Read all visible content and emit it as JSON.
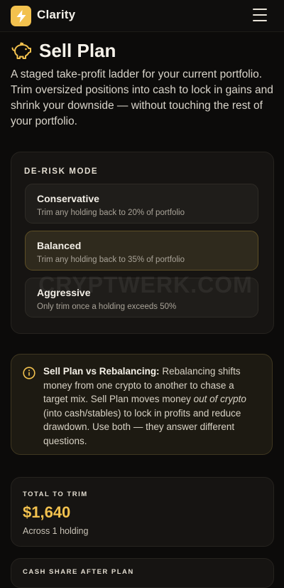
{
  "app": {
    "brand": "Clarity",
    "logo_icon": "lightning-bolt-icon",
    "accent": "#f2c14e"
  },
  "page": {
    "title": "Sell Plan",
    "title_icon": "piggy-bank-icon",
    "intro": "A staged take-profit ladder for your current portfolio. Trim oversized positions into cash to lock in gains and shrink your downside — without touching the rest of your portfolio."
  },
  "derisk": {
    "label": "DE-RISK MODE",
    "selected": "Balanced",
    "options": [
      {
        "name": "Conservative",
        "desc": "Trim any holding back to 20% of portfolio"
      },
      {
        "name": "Balanced",
        "desc": "Trim any holding back to 35% of portfolio"
      },
      {
        "name": "Aggressive",
        "desc": "Only trim once a holding exceeds 50%"
      }
    ]
  },
  "watermark": "CRYPTWERK.COM",
  "info": {
    "icon": "info-icon",
    "heading": "Sell Plan vs Rebalancing:",
    "text1": " Rebalancing shifts money from one crypto to another to chase a target mix. Sell Plan moves money ",
    "emphasis": "out of crypto",
    "text2": " (into cash/stables) to lock in profits and reduce drawdown. Use both — they answer different questions."
  },
  "total": {
    "label": "TOTAL TO TRIM",
    "value": "$1,640",
    "sub": "Across 1 holding"
  },
  "next": {
    "label": "CASH SHARE AFTER PLAN"
  }
}
